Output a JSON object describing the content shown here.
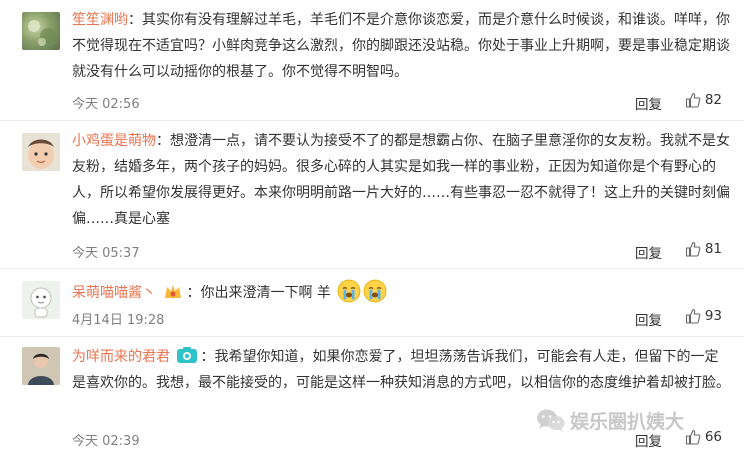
{
  "comments": [
    {
      "username": "笙笙渊哟",
      "colon": "：",
      "text": "其实你有没有理解过羊毛，羊毛们不是介意你谈恋爱，而是介意什么时候谈，和谁谈。咩咩，你不觉得现在不适宜吗？小鲜肉竞争这么激烈，你的脚跟还没站稳。你处于事业上升期啊，要是事业稳定期谈就没有什么可以动摇你的根基了。你不觉得不明智吗。",
      "time": "今天 02:56",
      "reply_label": "回复",
      "likes": "82"
    },
    {
      "username": "小鸡蛋是萌物",
      "colon": "：",
      "text": "想澄清一点，请不要认为接受不了的都是想霸占你、在脑子里意淫你的女友粉。我就不是女友粉，结婚多年，两个孩子的妈妈。很多心碎的人其实是如我一样的事业粉，正因为知道你是个有野心的人，所以希望你发展得更好。本来你明明前路一片大好的……有些事忍一忍不就得了！这上升的关键时刻偏偏……真是心塞",
      "time": "今天 05:37",
      "reply_label": "回复",
      "likes": "81"
    },
    {
      "username": "呆萌喵喵酱丶",
      "colon": "：",
      "text": "你出来澄清一下啊 羊",
      "time": "4月14日 19:28",
      "reply_label": "回复",
      "likes": "93"
    },
    {
      "username": "为咩而来的君君",
      "colon": "：",
      "text": "我希望你知道，如果你恋爱了，坦坦荡荡告诉我们，可能会有人走，但留下的一定是喜欢你的。我想，最不能接受的，可能是这样一种获知消息的方式吧，以相信你的态度维护着却被打脸。",
      "time": "今天 02:39",
      "reply_label": "回复",
      "likes": "66"
    }
  ],
  "watermark": {
    "text": "娱乐圈扒姨大",
    "icon": "wechat-icon"
  },
  "colors": {
    "username": "#eb7350",
    "text": "#333333",
    "meta": "#808080",
    "divider": "#ececec"
  }
}
